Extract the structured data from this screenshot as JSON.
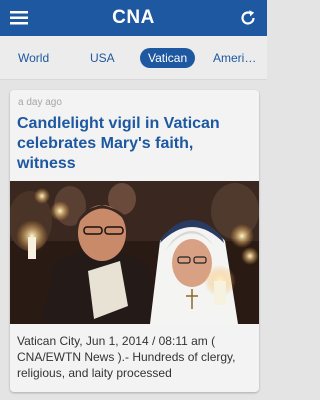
{
  "app": {
    "title": "CNA"
  },
  "icons": {
    "menu": "menu-icon",
    "refresh": "refresh-icon"
  },
  "tabs": [
    {
      "label": "World",
      "active": false
    },
    {
      "label": "USA",
      "active": false
    },
    {
      "label": "Vatican",
      "active": true
    },
    {
      "label": "Ameri…",
      "active": false
    }
  ],
  "article": {
    "time": "a day ago",
    "headline": "Candlelight vigil in Vatican celebrates Mary's faith, witness",
    "summary": "Vatican City, Jun 1, 2014 / 08:11 am ( CNA/EWTN News ).- Hundreds of clergy, religious, and laity processed"
  },
  "colors": {
    "brand": "#1d58a0",
    "tab_bg": "#ececec",
    "page_bg": "#e4e4e4"
  }
}
